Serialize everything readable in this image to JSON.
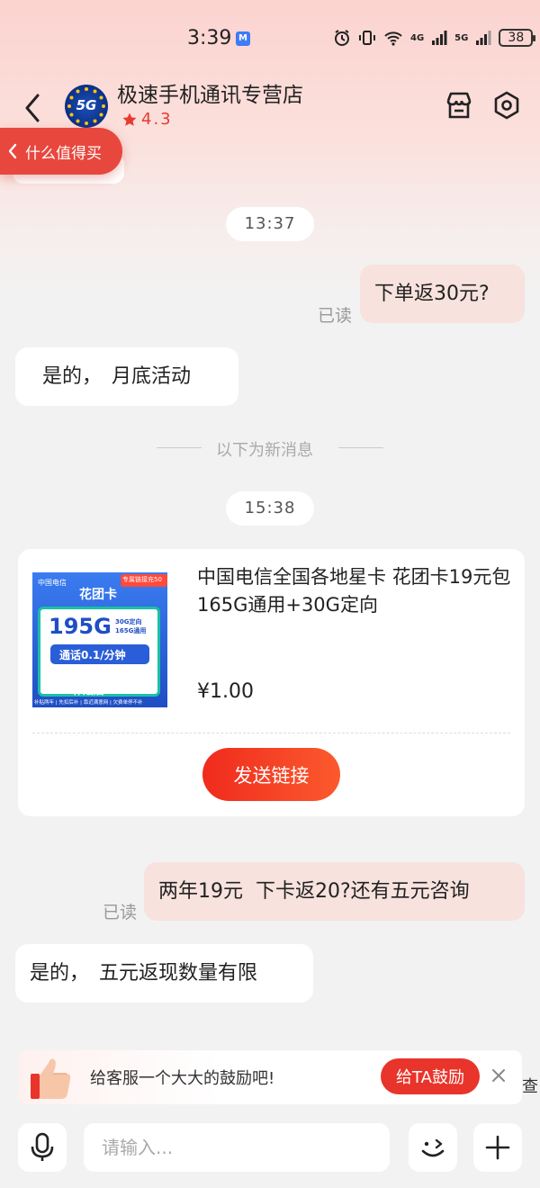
{
  "status_bar": {
    "time": "3:39",
    "app_badge": "M",
    "network_1": "4G",
    "network_2": "5G",
    "battery": "38"
  },
  "header": {
    "shop_avatar_text": "5G",
    "shop_name": "极速手机通讯专营店",
    "rating": "4.3"
  },
  "floating_pill": {
    "label": "什么值得买"
  },
  "messages": {
    "time_1": "13:37",
    "out_1": "下单返30元?",
    "read_1": "已读",
    "in_1": "是的，　月底活动",
    "divider": "以下为新消息",
    "time_2": "15:38",
    "out_2": "两年19元  下卡返20?还有五元咨询",
    "read_2": "已读",
    "in_2": "是的，　五元返现数量有限"
  },
  "product_card": {
    "title": "中国电信全国各地星卡  花团卡19元包165G通用+30G定向",
    "price": "¥1.00",
    "send_button": "发送链接",
    "image": {
      "brand": "中国电信",
      "card_name": "花团卡",
      "corner_tag": "专属链接充50",
      "data_amount": "195G",
      "data_detail_1": "30G定向",
      "data_detail_2": "165G通用",
      "call_rate": "通话0.1/分钟",
      "subsidy": "补贴后19",
      "footer": "补贴两年 | 先扣后补 | 靠近满意网 | 欠费单停不补"
    }
  },
  "encourage": {
    "text": "给客服一个大大的鼓励吧!",
    "button": "给TA鼓励",
    "edge_text": "查"
  },
  "input_bar": {
    "placeholder": "请输入..."
  },
  "colors": {
    "accent": "#e8342a",
    "outgoing_bubble": "#f7e2dd",
    "background": "#f2f2f2"
  }
}
